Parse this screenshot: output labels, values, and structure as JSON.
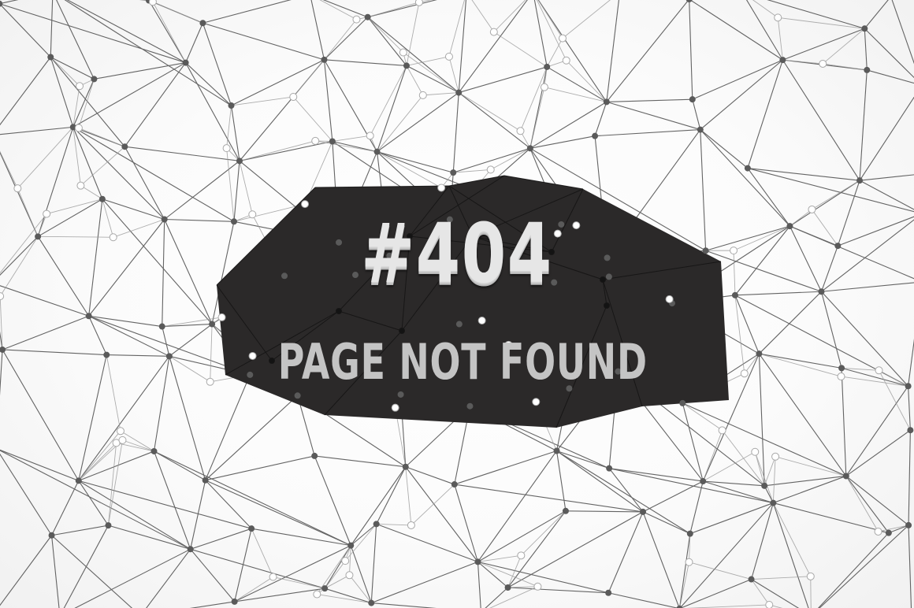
{
  "banner": {
    "headline": "#404",
    "message": "PAGE NOT FOUND"
  },
  "colors": {
    "background": "#ffffff",
    "mesh_line": "#4a4a4a",
    "mesh_node_dark": "#5a5a5a",
    "mesh_node_light": "#ffffff",
    "banner_fill": "#2b2929",
    "headline_text": "#e6e6e6",
    "message_text": "#c4c4c4"
  }
}
